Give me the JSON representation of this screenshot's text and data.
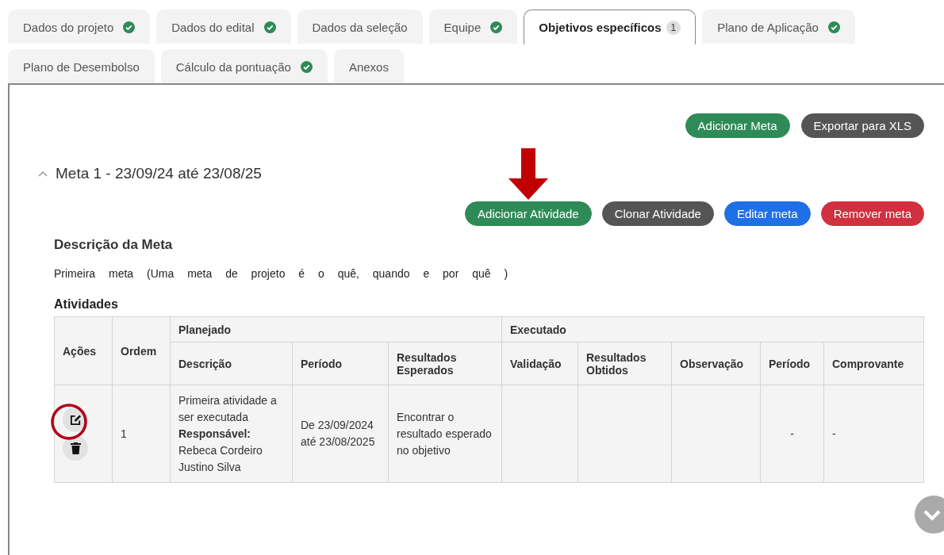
{
  "tabs": [
    {
      "label": "Dados do projeto",
      "selected": false,
      "complete": true
    },
    {
      "label": "Dados do edital",
      "selected": false,
      "complete": true
    },
    {
      "label": "Dados da seleção",
      "selected": false,
      "complete": false
    },
    {
      "label": "Equipe",
      "selected": false,
      "complete": true
    },
    {
      "label": "Objetivos específicos",
      "selected": true,
      "complete": false,
      "badge": "1"
    },
    {
      "label": "Plano de Aplicação",
      "selected": false,
      "complete": true
    },
    {
      "label": "Plano de Desembolso",
      "selected": false,
      "complete": false
    },
    {
      "label": "Cálculo da pontuação",
      "selected": false,
      "complete": true
    },
    {
      "label": "Anexos",
      "selected": false,
      "complete": false
    }
  ],
  "top_buttons": [
    {
      "label": "Adicionar Meta",
      "kind": "success"
    },
    {
      "label": "Exportar para XLS",
      "kind": "dark"
    }
  ],
  "meta": {
    "title": "Meta 1 - 23/09/24 até 23/08/25",
    "expanded": true,
    "buttons": [
      {
        "label": "Adicionar Atividade",
        "kind": "success",
        "arrow_marked": true
      },
      {
        "label": "Clonar Atividade",
        "kind": "dark",
        "arrow_marked": false
      },
      {
        "label": "Editar meta",
        "kind": "primary",
        "arrow_marked": false
      },
      {
        "label": "Remover meta",
        "kind": "danger",
        "arrow_marked": false
      }
    ],
    "description_heading": "Descrição da Meta",
    "description": "Primeira meta (Uma meta de projeto é o quê, quando e por quê )",
    "activities_heading": "Atividades",
    "table": {
      "groups": [
        {
          "label": "Planejado"
        },
        {
          "label": "Executado"
        }
      ],
      "fixed_columns": [
        "Ações",
        "Ordem"
      ],
      "columns": [
        "Descrição",
        "Período",
        "Resultados Esperados",
        "Validação",
        "Resultados Obtidos",
        "Observação",
        "Período",
        "Comprovante"
      ],
      "rows": [
        {
          "edit_circled": true,
          "order": "1",
          "description": "Primeira atividade a ser executada",
          "responsible": "**Responsável:** Rebeca Cordeiro Justino Silva",
          "period": "De 23/09/2024 até 23/08/2025",
          "expected": "Encontrar o resultado esperado no objetivo",
          "exec_period": "-",
          "proof": "-"
        }
      ]
    }
  }
}
